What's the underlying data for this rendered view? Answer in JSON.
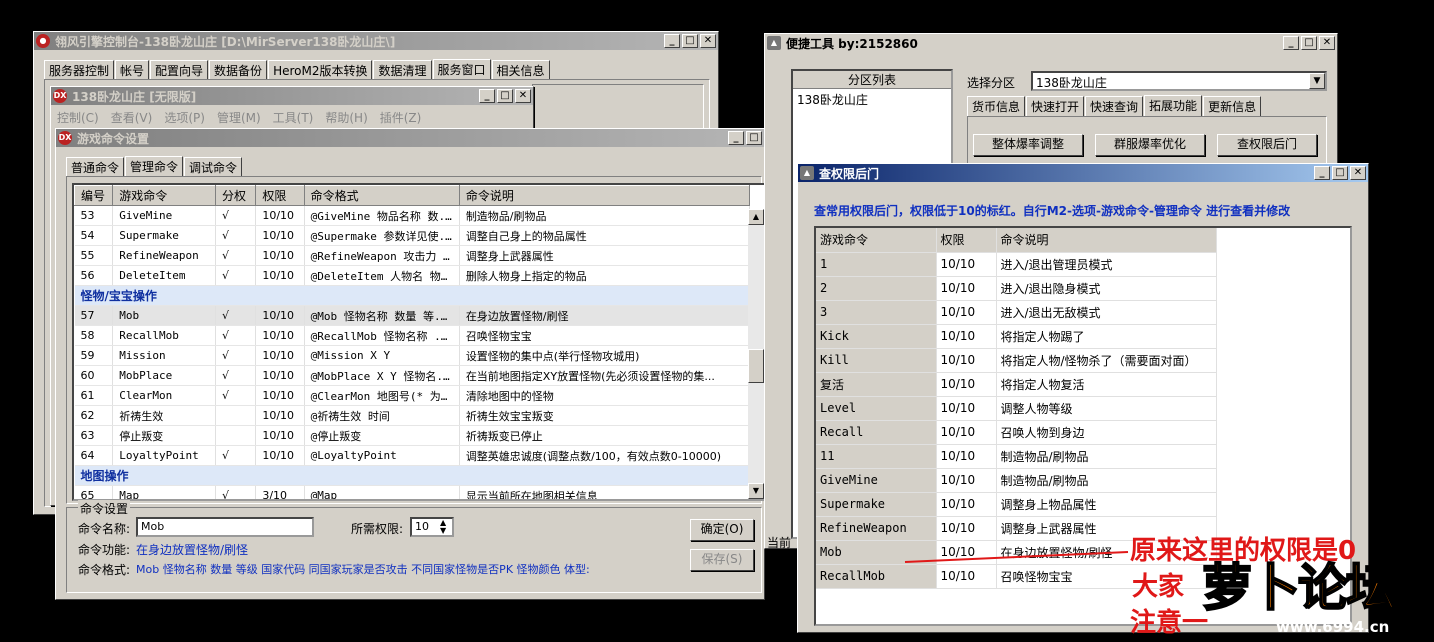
{
  "main_window": {
    "title": "翎风引擎控制台-138卧龙山庄 [D:\\MirServer138卧龙山庄\\]",
    "tabs": [
      "服务器控制",
      "帐号",
      "配置向导",
      "数据备份",
      "HeroM2版本转换",
      "数据清理",
      "服务窗口",
      "相关信息"
    ],
    "selected_tab": "服务窗口"
  },
  "m2_window": {
    "title": "138卧龙山庄 [无限版]",
    "menu": [
      "控制(C)",
      "查看(V)",
      "选项(P)",
      "管理(M)",
      "工具(T)",
      "帮助(H)",
      "插件(Z)"
    ]
  },
  "cmd_window": {
    "title": "游戏命令设置",
    "tabs": [
      "普通命令",
      "管理命令",
      "调试命令"
    ],
    "selected_tab": "管理命令",
    "columns": [
      "编号",
      "游戏命令",
      "分权",
      "权限",
      "命令格式",
      "命令说明"
    ],
    "rows": [
      {
        "type": "row",
        "no": "53",
        "cmd": "GiveMine",
        "perm": "√",
        "lvl": "10/10",
        "fmt": "@GiveMine 物品名称 数...",
        "desc": "制造物品/刷物品"
      },
      {
        "type": "row",
        "no": "54",
        "cmd": "Supermake",
        "perm": "√",
        "lvl": "10/10",
        "fmt": "@Supermake 参数详见使...",
        "desc": "调整自己身上的物品属性"
      },
      {
        "type": "row",
        "no": "55",
        "cmd": "RefineWeapon",
        "perm": "√",
        "lvl": "10/10",
        "fmt": "@RefineWeapon 攻击力 ...",
        "desc": "调整身上武器属性"
      },
      {
        "type": "row",
        "no": "56",
        "cmd": "DeleteItem",
        "perm": "√",
        "lvl": "10/10",
        "fmt": "@DeleteItem 人物名 物...",
        "desc": "删除人物身上指定的物品"
      },
      {
        "type": "group",
        "label": "怪物/宝宝操作"
      },
      {
        "type": "row",
        "hl": true,
        "no": "57",
        "cmd": "Mob",
        "perm": "√",
        "lvl": "10/10",
        "fmt": "@Mob 怪物名称 数量 等...",
        "desc": "在身边放置怪物/刷怪"
      },
      {
        "type": "row",
        "no": "58",
        "cmd": "RecallMob",
        "perm": "√",
        "lvl": "10/10",
        "fmt": "@RecallMob 怪物名称 ...",
        "desc": "召唤怪物宝宝"
      },
      {
        "type": "row",
        "no": "59",
        "cmd": "Mission",
        "perm": "√",
        "lvl": "10/10",
        "fmt": "@Mission X  Y",
        "desc": "设置怪物的集中点(举行怪物攻城用)"
      },
      {
        "type": "row",
        "no": "60",
        "cmd": "MobPlace",
        "perm": "√",
        "lvl": "10/10",
        "fmt": "@MobPlace X  Y 怪物名...",
        "desc": "在当前地图指定XY放置怪物(先必须设置怪物的集..."
      },
      {
        "type": "row",
        "no": "61",
        "cmd": "ClearMon",
        "perm": "√",
        "lvl": "10/10",
        "fmt": "@ClearMon 地图号(* 为...",
        "desc": "清除地图中的怪物"
      },
      {
        "type": "row",
        "no": "62",
        "cmd": "祈祷生效",
        "perm": "",
        "lvl": "10/10",
        "fmt": "@祈祷生效 时间",
        "desc": "祈祷生效宝宝叛变"
      },
      {
        "type": "row",
        "no": "63",
        "cmd": "停止叛变",
        "perm": "",
        "lvl": "10/10",
        "fmt": "@停止叛变",
        "desc": "祈祷叛变已停止"
      },
      {
        "type": "row",
        "no": "64",
        "cmd": "LoyaltyPoint",
        "perm": "√",
        "lvl": "10/10",
        "fmt": "@LoyaltyPoint",
        "desc": "调整英雄忠诚度(调整点数/100，有效点数0-10000)"
      },
      {
        "type": "group",
        "label": "地图操作"
      },
      {
        "type": "row",
        "no": "65",
        "cmd": "Map",
        "perm": "√",
        "lvl": "3/10",
        "fmt": "@Map",
        "desc": "显示当前所在地图相关信息"
      }
    ],
    "settings": {
      "group_label": "命令设置",
      "name_label": "命令名称:",
      "name_value": "Mob",
      "req_label": "所需权限:",
      "req_value": "10",
      "func_label": "命令功能:",
      "func_value": "在身边放置怪物/刷怪",
      "fmt_label": "命令格式:",
      "fmt_value": "Mob 怪物名称 数量 等级 国家代码 同国家玩家是否攻击 不同国家怪物是否PK 怪物颜色 体型:",
      "ok_label": "确定(O)",
      "save_label": "保存(S)"
    }
  },
  "tools_window": {
    "title": "便捷工具  by:2152860",
    "partition_header": "分区列表",
    "partition_item": "138卧龙山庄",
    "select_label": "选择分区",
    "select_value": "138卧龙山庄",
    "tabs": [
      "货币信息",
      "快速打开",
      "快速查询",
      "拓展功能",
      "更新信息"
    ],
    "selected_tab": "拓展功能",
    "buttons": [
      "整体爆率调整",
      "群服爆率优化",
      "查权限后门"
    ],
    "status_text": "当前"
  },
  "backdoor_window": {
    "title": "查权限后门",
    "notice": "查常用权限后门，权限低于10的标红。自行M2-选项-游戏命令-管理命令 进行查看并修改",
    "columns": [
      "游戏命令",
      "权限",
      "命令说明"
    ],
    "rows": [
      {
        "cmd": "1",
        "lvl": "10/10",
        "desc": "进入/退出管理员模式"
      },
      {
        "cmd": "2",
        "lvl": "10/10",
        "desc": "进入/退出隐身模式"
      },
      {
        "cmd": "3",
        "lvl": "10/10",
        "desc": "进入/退出无敌模式"
      },
      {
        "cmd": "Kick",
        "lvl": "10/10",
        "desc": "将指定人物踢了"
      },
      {
        "cmd": "Kill",
        "lvl": "10/10",
        "desc": "将指定人物/怪物杀了（需要面对面）"
      },
      {
        "cmd": "复活",
        "lvl": "10/10",
        "desc": "将指定人物复活"
      },
      {
        "cmd": "Level",
        "lvl": "10/10",
        "desc": "调整人物等级"
      },
      {
        "cmd": "Recall",
        "lvl": "10/10",
        "desc": "召唤人物到身边"
      },
      {
        "cmd": "11",
        "lvl": "10/10",
        "desc": "制造物品/刷物品"
      },
      {
        "cmd": "GiveMine",
        "lvl": "10/10",
        "desc": "制造物品/刷物品"
      },
      {
        "cmd": "Supermake",
        "lvl": "10/10",
        "desc": "调整身上物品属性"
      },
      {
        "cmd": "RefineWeapon",
        "lvl": "10/10",
        "desc": "调整身上武器属性"
      },
      {
        "cmd": "Mob",
        "lvl": "10/10",
        "desc": "在身边放置怪物/刷怪"
      },
      {
        "cmd": "RecallMob",
        "lvl": "10/10",
        "desc": "召唤怪物宝宝"
      }
    ]
  },
  "overlay": {
    "line1": "原来这里的权限是0",
    "line2": "大家",
    "line3": "注意一",
    "logo_text": "萝卜论坛",
    "logo_url": "www.6994.cn"
  },
  "colors": {
    "title_active": "#0a246a",
    "notice_blue": "#1030c0",
    "annotation_red": "#e01818",
    "logo_orange": "#f07800"
  }
}
